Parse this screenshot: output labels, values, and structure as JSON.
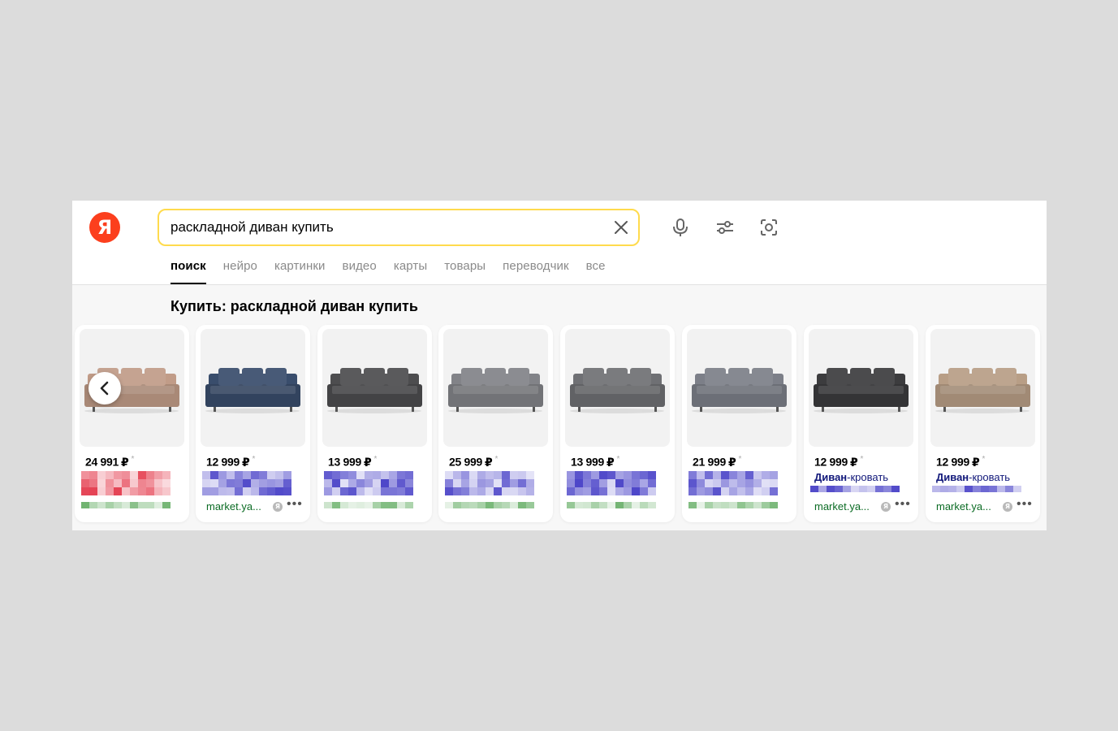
{
  "logo": {
    "text": "Я",
    "color": "#fc3f1d"
  },
  "search": {
    "query": "раскладной диван купить",
    "border_color": "#ffdb4d",
    "icons": [
      "close-icon",
      "microphone-icon",
      "filter-icon",
      "camera-icon"
    ]
  },
  "tabs": [
    {
      "label": "поиск",
      "active": true
    },
    {
      "label": "нейро",
      "active": false
    },
    {
      "label": "картинки",
      "active": false
    },
    {
      "label": "видео",
      "active": false
    },
    {
      "label": "карты",
      "active": false
    },
    {
      "label": "товары",
      "active": false
    },
    {
      "label": "переводчик",
      "active": false
    },
    {
      "label": "все",
      "active": false
    }
  ],
  "section": {
    "title": "Купить: раскладной диван купить"
  },
  "carousel": {
    "prev_icon": "chevron-left-icon"
  },
  "products": [
    {
      "price": "24 991",
      "currency": "₽",
      "sofa_color": "#c19c88",
      "pixel_color": "#e43d4f",
      "title_bold": "",
      "title_rest": "",
      "domain": "",
      "has_actions": false
    },
    {
      "price": "12 999",
      "currency": "₽",
      "sofa_color": "#394d6c",
      "pixel_color": "#4c45c8",
      "title_bold": "",
      "title_rest": "",
      "domain": "market.ya...",
      "has_actions": true
    },
    {
      "price": "13 999",
      "currency": "₽",
      "sofa_color": "#4d4d4f",
      "pixel_color": "#4c45c8",
      "title_bold": "",
      "title_rest": "",
      "domain": "",
      "has_actions": false
    },
    {
      "price": "25 999",
      "currency": "₽",
      "sofa_color": "#828388",
      "pixel_color": "#4c45c8",
      "title_bold": "",
      "title_rest": "",
      "domain": "",
      "has_actions": false
    },
    {
      "price": "13 999",
      "currency": "₽",
      "sofa_color": "#6f7074",
      "pixel_color": "#4c45c8",
      "title_bold": "",
      "title_rest": "",
      "domain": "",
      "has_actions": false
    },
    {
      "price": "21 999",
      "currency": "₽",
      "sofa_color": "#7c7f88",
      "pixel_color": "#4c45c8",
      "title_bold": "",
      "title_rest": "",
      "domain": "",
      "has_actions": false
    },
    {
      "price": "12 999",
      "currency": "₽",
      "sofa_color": "#3c3c3e",
      "pixel_color": "#4c45c8",
      "title_bold": "Диван",
      "title_rest": "-кровать",
      "domain": "market.ya...",
      "has_actions": true
    },
    {
      "price": "12 999",
      "currency": "₽",
      "sofa_color": "#b89e86",
      "pixel_color": "#4c45c8",
      "title_bold": "Диван",
      "title_rest": "-кровать",
      "domain": "market.ya...",
      "has_actions": true
    }
  ],
  "badge_text": "Я",
  "more_text": "•••",
  "price_note": "*"
}
